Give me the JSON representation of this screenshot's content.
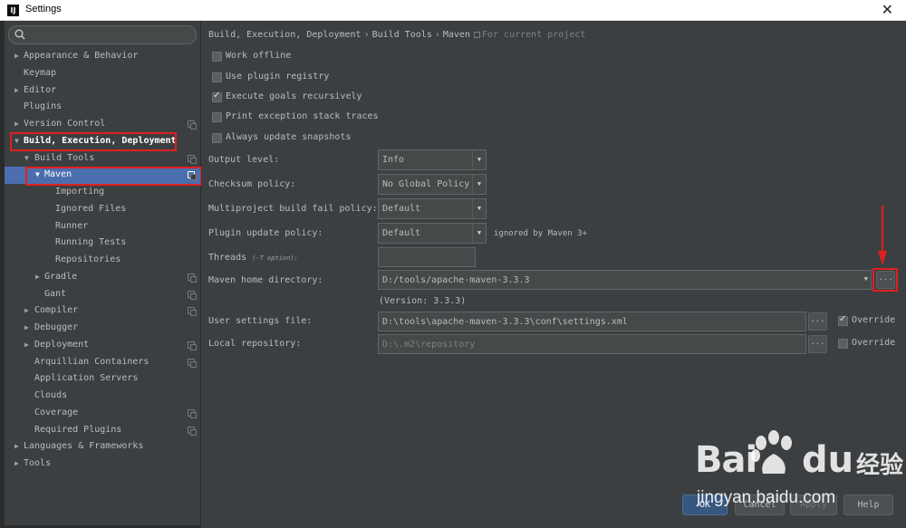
{
  "window": {
    "title": "Settings",
    "app_icon": "intellij-icon",
    "close_label": "✕"
  },
  "search": {
    "placeholder": "",
    "icon": "search-icon"
  },
  "tree": [
    {
      "label": "Appearance & Behavior",
      "arrow": "▶"
    },
    {
      "label": "Keymap",
      "arrow": ""
    },
    {
      "label": "Editor",
      "arrow": "▶"
    },
    {
      "label": "Plugins",
      "arrow": ""
    },
    {
      "label": "Version Control",
      "arrow": "▶"
    },
    {
      "label": "Build, Execution, Deployment",
      "arrow": "▼"
    },
    {
      "label": "Build Tools",
      "arrow": "▼"
    },
    {
      "label": "Maven",
      "arrow": "▼"
    },
    {
      "label": "Importing",
      "arrow": ""
    },
    {
      "label": "Ignored Files",
      "arrow": ""
    },
    {
      "label": "Runner",
      "arrow": ""
    },
    {
      "label": "Running Tests",
      "arrow": ""
    },
    {
      "label": "Repositories",
      "arrow": ""
    },
    {
      "label": "Gradle",
      "arrow": "▶"
    },
    {
      "label": "Gant",
      "arrow": ""
    },
    {
      "label": "Compiler",
      "arrow": "▶"
    },
    {
      "label": "Debugger",
      "arrow": "▶"
    },
    {
      "label": "Deployment",
      "arrow": "▶"
    },
    {
      "label": "Arquillian Containers",
      "arrow": ""
    },
    {
      "label": "Application Servers",
      "arrow": ""
    },
    {
      "label": "Clouds",
      "arrow": ""
    },
    {
      "label": "Coverage",
      "arrow": ""
    },
    {
      "label": "Required Plugins",
      "arrow": ""
    },
    {
      "label": "Languages & Frameworks",
      "arrow": "▶"
    },
    {
      "label": "Tools",
      "arrow": "▶"
    }
  ],
  "breadcrumb": {
    "parts": [
      "Build, Execution, Deployment",
      "Build Tools",
      "Maven"
    ],
    "separator": "›",
    "hint": "For current project"
  },
  "checkboxes": [
    {
      "label": "Work offline",
      "checked": false
    },
    {
      "label": "Use plugin registry",
      "checked": false
    },
    {
      "label": "Execute goals recursively",
      "checked": true
    },
    {
      "label": "Print exception stack traces",
      "checked": false
    },
    {
      "label": "Always update snapshots",
      "checked": false
    }
  ],
  "fields": {
    "output_level": {
      "label": "Output level:",
      "value": "Info"
    },
    "checksum_policy": {
      "label": "Checksum policy:",
      "value": "No Global Policy"
    },
    "multiproject_policy": {
      "label": "Multiproject build fail policy:",
      "value": "Default"
    },
    "plugin_update_policy": {
      "label": "Plugin update policy:",
      "value": "Default",
      "note": "ignored by Maven 3+"
    },
    "threads": {
      "label": "Threads",
      "hint": "(-T option):",
      "value": ""
    },
    "maven_home": {
      "label": "Maven home directory:",
      "value": "D:/tools/apache-maven-3.3.3",
      "version": "(Version: 3.3.3)"
    },
    "user_settings": {
      "label": "User settings file:",
      "value": "D:\\tools\\apache-maven-3.3.3\\conf\\settings.xml",
      "override_label": "Override",
      "override_checked": true
    },
    "local_repo": {
      "label": "Local repository:",
      "value": "D:\\.m2\\repository",
      "override_label": "Override",
      "override_checked": false
    }
  },
  "browse_label": "...",
  "dropdown_glyph": "▼",
  "buttons": {
    "ok": "OK",
    "cancel": "Cancel",
    "apply": "Apply",
    "help": "Help"
  },
  "watermark": {
    "bai": "Bai",
    "du": "du",
    "cn": "经验",
    "url": "jingyan.baidu.com"
  },
  "colors": {
    "annotation_red": "#e02020",
    "selection_blue": "#4b6eaf",
    "panel_bg": "#3c3f41"
  }
}
